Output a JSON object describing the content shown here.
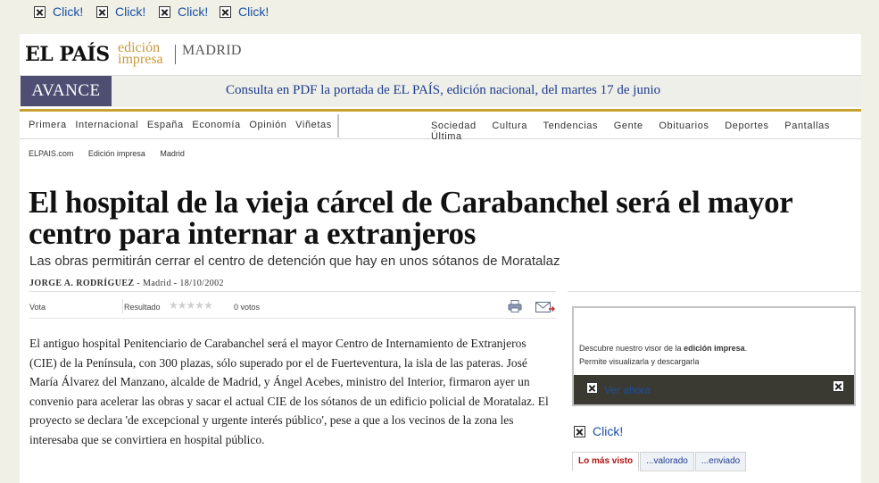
{
  "top_ads": [
    "Click!",
    "Click!",
    "Click!",
    "Click!"
  ],
  "masthead": {
    "logo": "EL PAÍS",
    "logo_sub_1": "edición",
    "logo_sub_2": "impresa",
    "city": "MADRID"
  },
  "avance": {
    "badge": "AVANCE",
    "text": "Consulta en PDF la portada de EL PAÍS, edición nacional, del martes 17 de junio"
  },
  "nav": {
    "left": [
      "Primera",
      "Internacional",
      "España",
      "Economía",
      "Opinión",
      "Viñetas"
    ],
    "right": [
      "Sociedad",
      "Cultura",
      "Tendencias",
      "Gente",
      "Obituarios",
      "Deportes",
      "Pantallas",
      "Última"
    ]
  },
  "breadcrumb": [
    "ELPAIS.com",
    "Edición impresa",
    "Madrid"
  ],
  "article": {
    "headline": "El hospital de la vieja cárcel de Carabanchel será el mayor centro para internar a extranjeros",
    "subhead": "Las obras permitirán cerrar el centro de detención que hay en unos sótanos de Moratalaz",
    "author": "JORGE A. RODRÍGUEZ",
    "dateline": "- Madrid - 18/10/2002",
    "body": "El antiguo hospital Penitenciario de Carabanchel será el mayor Centro de Internamiento de Extranjeros (CIE) de la Península, con 300 plazas, sólo superado por el de Fuerteventura, la isla de las pateras. José María Álvarez del Manzano, alcalde de Madrid, y Ángel Acebes, ministro del Interior, firmaron ayer un convenio para acelerar las obras y sacar el actual CIE de los sótanos de un edificio policial de Moratalaz. El proyecto se declara 'de excepcional y urgente interés público', pese a que a los vecinos de la zona les interesaba que se convirtiera en hospital público."
  },
  "voting": {
    "vota_label": "Vota",
    "result_label": "Resultado",
    "rating": 0,
    "votes_text": "0 votos"
  },
  "visor": {
    "line1_prefix": "Descubre nuestro visor de la ",
    "line1_bold": "edición impresa",
    "line1_suffix": ".",
    "line2": "Permite visualizarla y descargarla",
    "link": "Ver ahora"
  },
  "side_ad": "Click!",
  "tabs": [
    "Lo más visto",
    "...valorado",
    "...enviado"
  ],
  "colors": {
    "accent_gold": "#c9a130",
    "avance_badge": "#4d4e72",
    "link_blue": "#1a4fa3",
    "tab_active_red": "#b21010"
  }
}
